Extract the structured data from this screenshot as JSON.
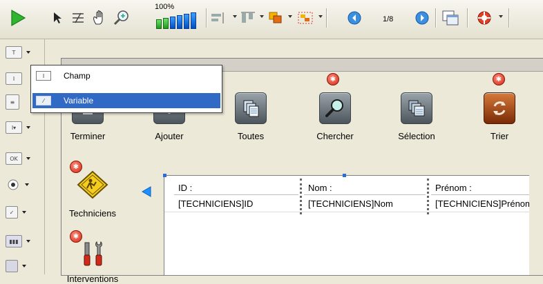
{
  "toolbar": {
    "zoom_label": "100%",
    "page_indicator": "1/8",
    "icons": [
      "run-icon",
      "pointer-icon",
      "tab-order-icon",
      "hand-icon",
      "zoom-icon",
      "zoom-level-icon",
      "align-icon",
      "distribute-icon",
      "bring-front-icon",
      "group-icon",
      "previous-page-icon",
      "next-page-icon",
      "windows-icon",
      "help-icon"
    ]
  },
  "popup": {
    "items": [
      {
        "label": "Champ",
        "icon": "field-icon",
        "selected": false
      },
      {
        "label": "Variable",
        "icon": "variable-icon",
        "selected": true
      }
    ]
  },
  "buttons": [
    {
      "label": "Terminer",
      "icon": "terminate-icon"
    },
    {
      "label": "Ajouter",
      "icon": "add-icon"
    },
    {
      "label": "Toutes",
      "icon": "all-records-icon"
    },
    {
      "label": "Chercher",
      "icon": "search-icon"
    },
    {
      "label": "Sélection",
      "icon": "selection-icon"
    },
    {
      "label": "Trier",
      "icon": "sort-icon"
    }
  ],
  "side_nav": [
    {
      "label": "Techniciens",
      "icon": "technicians-icon"
    },
    {
      "label": "Interventions",
      "icon": "interventions-icon"
    }
  ],
  "table": {
    "columns": [
      "ID :",
      "Nom :",
      "Prénom :"
    ],
    "row": [
      "[TECHNICIENS]ID",
      "[TECHNICIENS]Nom",
      "[TECHNICIENS]Prénom"
    ]
  },
  "colors": {
    "selection": "#316ac5",
    "badge": "#d22a14",
    "arrow": "#1e90ff"
  }
}
